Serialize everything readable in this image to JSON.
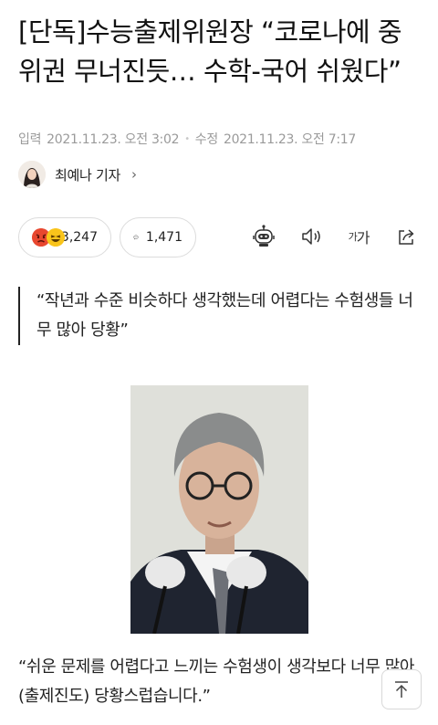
{
  "article": {
    "title": "[단독]수능출제위원장 “코로나에 중위권 무너진듯… 수학-국어 쉬웠다”",
    "published_label": "입력",
    "published_at": "2021.11.23. 오전 3:02",
    "modified_label": "수정",
    "modified_at": "2021.11.23. 오전 7:17",
    "reporter": "최예나 기자",
    "reporter_chevron": "›"
  },
  "reactions": {
    "count": "3,247"
  },
  "comments": {
    "count": "1,471"
  },
  "toolbar": {
    "font_size_label_small": "가",
    "font_size_label_large": "가"
  },
  "quote": "“작년과 수준 비슷하다 생각했는데 어렵다는 수험생들 너무 많아 당황”",
  "paragraph": "“쉬운 문제를 어렵다고 느끼는 수험생이 생각보다 너무 많아 (출제진도) 당황스럽습니다.”",
  "icons": [
    "robot-icon",
    "speaker-icon",
    "share-icon",
    "comment-icon",
    "arrow-up-icon"
  ],
  "colors": {
    "angry_emoji": "#e8472f",
    "laugh_emoji": "#f9c41b",
    "meta_text": "#9a9a9a"
  }
}
